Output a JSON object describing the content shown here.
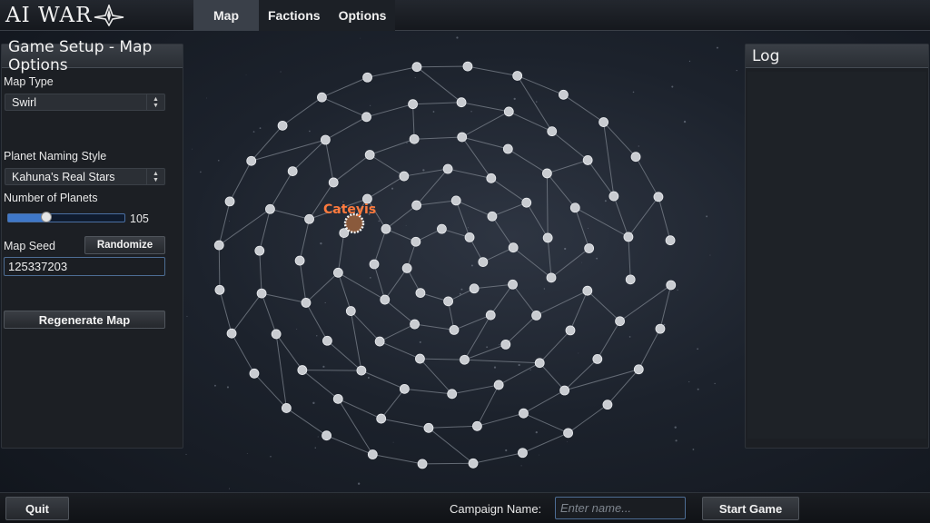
{
  "app": {
    "logo_text": "AI WAR",
    "logo_icon": "starship-emblem-icon"
  },
  "tabs": [
    {
      "label": "Map",
      "active": true
    },
    {
      "label": "Factions",
      "active": false
    },
    {
      "label": "Options",
      "active": false
    }
  ],
  "setup_panel": {
    "title": "Game Setup - Map Options",
    "map_type_label": "Map Type",
    "map_type_value": "Swirl",
    "naming_label": "Planet Naming Style",
    "naming_value": "Kahuna's Real Stars",
    "planets_label": "Number of Planets",
    "planets_value": "105",
    "planets_slider_fraction": 0.33,
    "seed_label": "Map Seed",
    "randomize_label": "Randomize",
    "seed_value": "125337203",
    "regenerate_label": "Regenerate Map"
  },
  "log_panel": {
    "title": "Log"
  },
  "galaxy": {
    "highlighted_planet": "Cateyis",
    "highlight_color": "#ff7a3d"
  },
  "bottom_bar": {
    "quit_label": "Quit",
    "campaign_label": "Campaign Name:",
    "campaign_placeholder": "Enter name...",
    "start_label": "Start Game"
  }
}
